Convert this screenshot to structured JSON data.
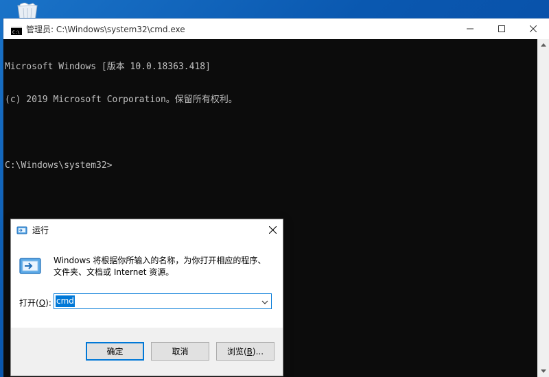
{
  "desktop": {
    "icon": "recycle-bin-icon"
  },
  "cmd_window": {
    "title": "管理员: C:\\Windows\\system32\\cmd.exe",
    "lines": [
      "Microsoft Windows [版本 10.0.18363.418]",
      "(c) 2019 Microsoft Corporation。保留所有权利。",
      "",
      "C:\\Windows\\system32>"
    ]
  },
  "run_dialog": {
    "title": "运行",
    "description": "Windows 将根据你所输入的名称，为你打开相应的程序、文件夹、文档或 Internet 资源。",
    "open_label_prefix": "打开(",
    "open_label_key": "O",
    "open_label_suffix": "):",
    "input_value": "cmd",
    "buttons": {
      "ok": "确定",
      "cancel": "取消",
      "browse_prefix": "浏览(",
      "browse_key": "B",
      "browse_suffix": ")..."
    }
  },
  "colors": {
    "desktop_accent": "#0a58b0",
    "console_bg": "#0c0c0c",
    "console_text": "#c0c0c0",
    "selection": "#0078d7"
  }
}
